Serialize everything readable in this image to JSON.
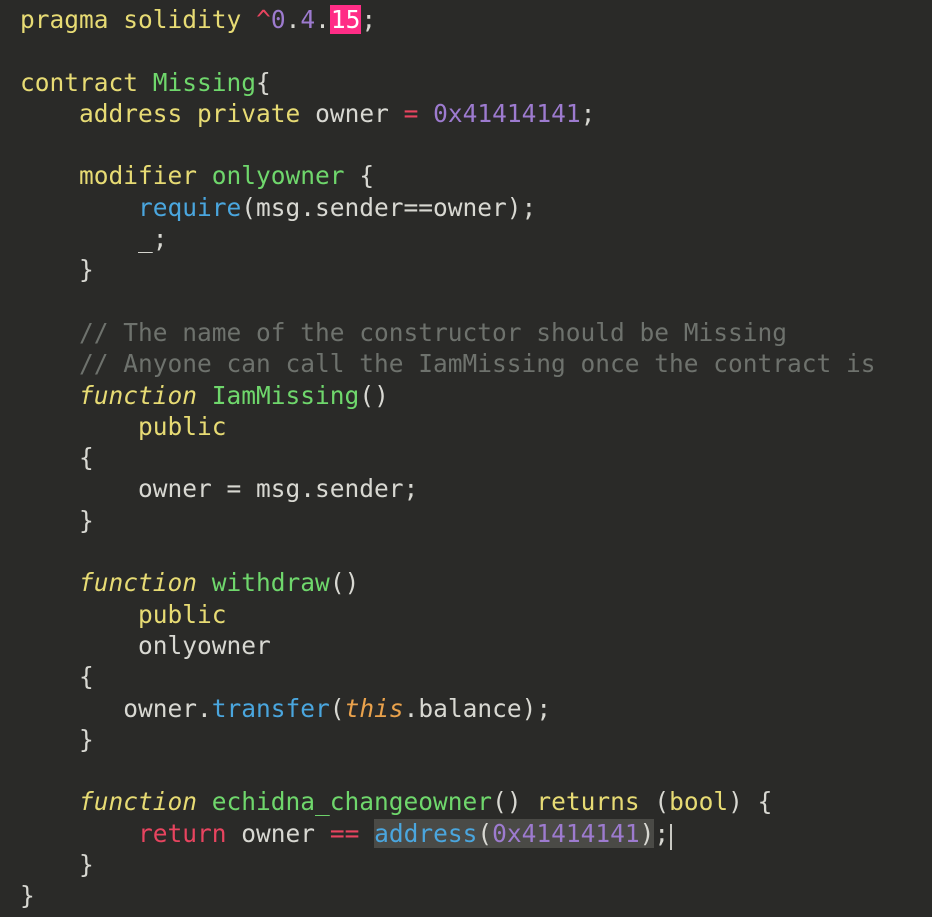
{
  "code": {
    "l01_pragma": "pragma",
    "l01_solidity": "solidity",
    "l01_caret": "^",
    "l01_zero": "0",
    "l01_four": "4",
    "l01_fifteen": "15",
    "l01_semi": ";",
    "l03_contract": "contract",
    "l03_name": "Missing",
    "l03_brace": "{",
    "l04_address": "address",
    "l04_private": "private",
    "l04_owner": "owner",
    "l04_eq": "=",
    "l04_val": "0x41414141",
    "l04_semi": ";",
    "l06_modifier": "modifier",
    "l06_name": "onlyowner",
    "l06_brace": "{",
    "l07_require": "require",
    "l07_args": "(msg.sender==owner);",
    "l08_under": "_;",
    "l09_close": "}",
    "l11_comment": "// The name of the constructor should be Missing",
    "l12_comment": "// Anyone can call the IamMissing once the contract is",
    "l13_function": "function",
    "l13_name": "IamMissing",
    "l13_paren": "()",
    "l14_public": "public",
    "l15_brace": "{",
    "l16_stmt": "owner = msg.sender;",
    "l17_close": "}",
    "l19_function": "function",
    "l19_name": "withdraw",
    "l19_paren": "()",
    "l20_public": "public",
    "l21_onlyowner": "onlyowner",
    "l22_brace": "{",
    "l23_owner": "owner.",
    "l23_transfer": "transfer",
    "l23_open": "(",
    "l23_this": "this",
    "l23_rest": ".balance);",
    "l24_close": "}",
    "l26_function": "function",
    "l26_name": "echidna_changeowner",
    "l26_paren": "()",
    "l26_returns": "returns",
    "l26_bool_open": "(",
    "l26_bool": "bool",
    "l26_bool_close": ") {",
    "l27_return": "return",
    "l27_owner": "owner",
    "l27_eqeq": "==",
    "l27_address": "address",
    "l27_open": "(",
    "l27_val": "0x41414141",
    "l27_close": ")",
    "l27_semi": ";",
    "l28_close": "}",
    "l29_close": "}"
  }
}
